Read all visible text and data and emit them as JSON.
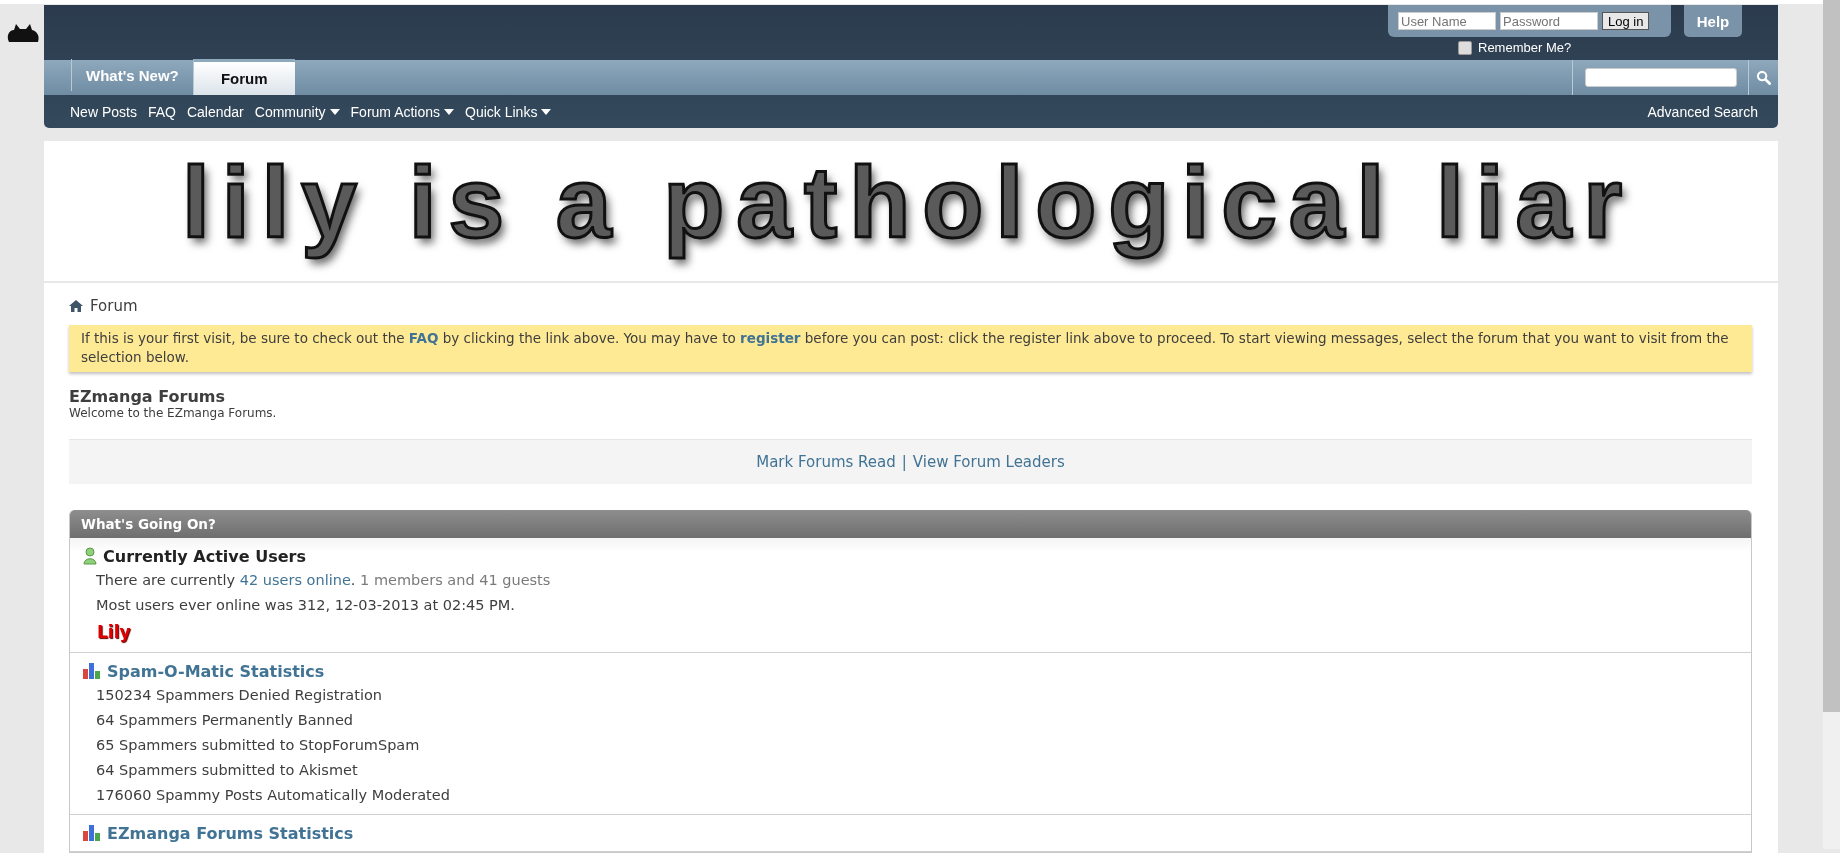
{
  "header": {
    "login": {
      "username_placeholder": "User Name",
      "password_placeholder": "Password",
      "button": "Log in",
      "remember_me": {
        "label": "Remember Me?",
        "checked": false
      }
    },
    "help": "Help"
  },
  "tabs": [
    {
      "label": "What's New?",
      "selected": false
    },
    {
      "label": "Forum",
      "selected": true
    }
  ],
  "nav_links": [
    {
      "label": "New Posts",
      "dropdown": false
    },
    {
      "label": "FAQ",
      "dropdown": false
    },
    {
      "label": "Calendar",
      "dropdown": false
    },
    {
      "label": "Community",
      "dropdown": true
    },
    {
      "label": "Forum Actions",
      "dropdown": true
    },
    {
      "label": "Quick Links",
      "dropdown": true
    }
  ],
  "advanced_search": "Advanced Search",
  "banner": {
    "text": "lily is a pathological liar"
  },
  "breadcrumb": "Forum",
  "notice": [
    {
      "kind": "text",
      "text": "If this is your first visit, be sure to check out the "
    },
    {
      "kind": "link",
      "text": "FAQ"
    },
    {
      "kind": "text",
      "text": " by clicking the link above. You may have to "
    },
    {
      "kind": "link",
      "text": "register"
    },
    {
      "kind": "text",
      "text": " before you can post: click the register link above to proceed. To start viewing messages, select the forum that you want to visit from the selection below."
    }
  ],
  "forum": {
    "title": "EZmanga Forums",
    "description": "Welcome to the EZmanga Forums."
  },
  "actions": {
    "links": [
      "Mark Forums Read",
      "View Forum Leaders"
    ],
    "separator": "|"
  },
  "whats_going_on": {
    "title": "What's Going On?",
    "sections": [
      {
        "kind": "users",
        "title": "Currently Active Users",
        "lines": [
          [
            {
              "kind": "text",
              "text": "There are currently "
            },
            {
              "kind": "link",
              "text": "42 users online"
            },
            {
              "kind": "text",
              "text": ". "
            },
            {
              "kind": "muted",
              "text": "1 members and 41 guests"
            }
          ],
          [
            {
              "kind": "text",
              "text": "Most users ever online was 312, 12-03-2013 at 02:45 PM."
            }
          ]
        ],
        "users": [
          "Lily"
        ]
      },
      {
        "kind": "stats",
        "title": "Spam-O-Matic Statistics",
        "lines": [
          [
            {
              "kind": "text",
              "text": "150234 Spammers Denied Registration"
            }
          ],
          [
            {
              "kind": "text",
              "text": "64 Spammers Permanently Banned"
            }
          ],
          [
            {
              "kind": "text",
              "text": "65 Spammers submitted to StopForumSpam"
            }
          ],
          [
            {
              "kind": "text",
              "text": "64 Spammers submitted to Akismet"
            }
          ],
          [
            {
              "kind": "text",
              "text": "176060 Spammy Posts Automatically Moderated"
            }
          ]
        ]
      },
      {
        "kind": "stats",
        "title": "EZmanga Forums Statistics"
      }
    ]
  }
}
